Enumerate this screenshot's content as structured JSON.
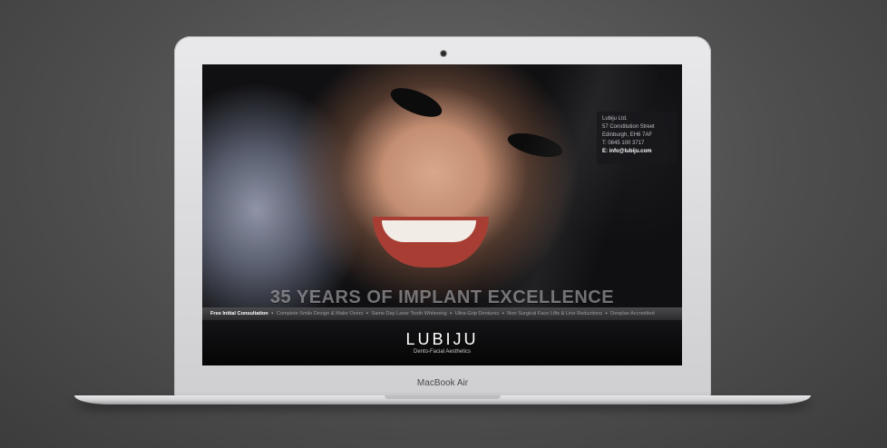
{
  "device": {
    "label": "MacBook Air"
  },
  "website": {
    "contact": {
      "company": "Lubiju Ltd.",
      "street": "57 Constitution Street",
      "city": "Edinburgh, EH6 7AF",
      "phone": "T: 0845 100 3717",
      "email": "E: info@lubiju.com"
    },
    "headline": "35 YEARS OF IMPLANT EXCELLENCE",
    "services": [
      "Free Initial Consultation",
      "Complete Smile Design & Make Overs",
      "Same Day Laser Tooth Whitening",
      "Ultra-Grip Dentures",
      "Non Surgical Face Lifts & Line Reductions",
      "Denplan Accredited"
    ],
    "separator": "•",
    "logo": "LUBIJU",
    "tagline": "Dento-Facial Aesthetics"
  }
}
